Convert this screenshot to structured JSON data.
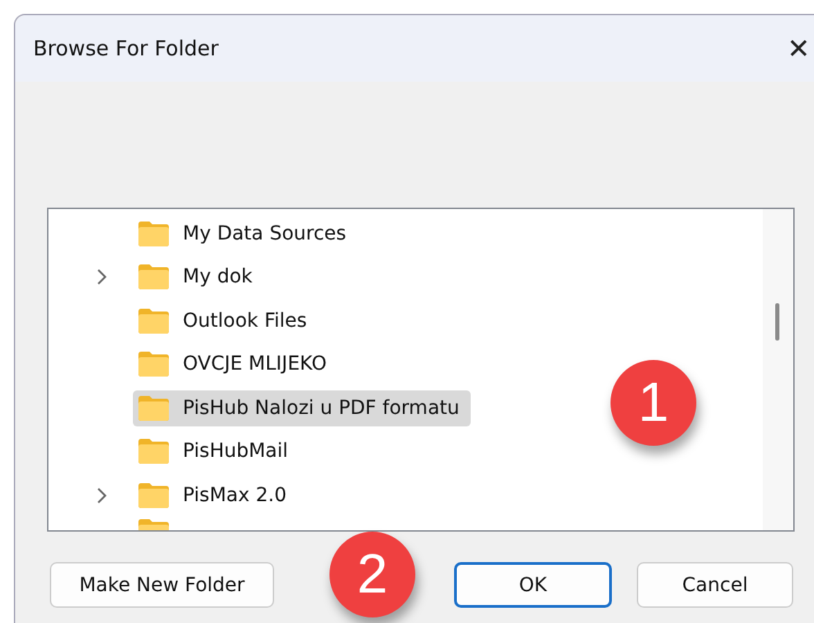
{
  "window": {
    "title": "Browse For Folder",
    "close": "✕"
  },
  "tree": {
    "items": [
      {
        "label": "My Data Sources",
        "expandable": false,
        "selected": false
      },
      {
        "label": "My dok",
        "expandable": true,
        "selected": false
      },
      {
        "label": "Outlook Files",
        "expandable": false,
        "selected": false
      },
      {
        "label": "OVCJE MLIJEKO",
        "expandable": false,
        "selected": false
      },
      {
        "label": "PisHub Nalozi u PDF formatu",
        "expandable": false,
        "selected": true
      },
      {
        "label": "PisHubMail",
        "expandable": false,
        "selected": false
      },
      {
        "label": "PisMax 2.0",
        "expandable": true,
        "selected": false
      }
    ],
    "cut_row": true
  },
  "buttons": [
    {
      "label": "Make New Folder",
      "default": false
    },
    {
      "label": "OK",
      "default": true
    },
    {
      "label": "Cancel",
      "default": false
    }
  ],
  "badges": [
    "1",
    "2"
  ]
}
